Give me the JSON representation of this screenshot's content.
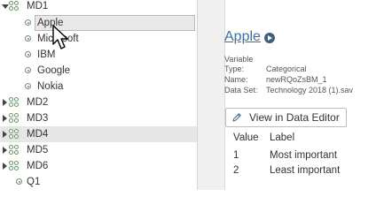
{
  "tree": {
    "groups": [
      {
        "label": "MD1",
        "expanded": true,
        "items": [
          "Apple",
          "Microsoft",
          "IBM",
          "Google",
          "Nokia"
        ]
      },
      {
        "label": "MD2",
        "expanded": false
      },
      {
        "label": "MD3",
        "expanded": false
      },
      {
        "label": "MD4",
        "expanded": false
      },
      {
        "label": "MD5",
        "expanded": false
      },
      {
        "label": "MD6",
        "expanded": false
      }
    ],
    "q1_label": "Q1",
    "selected_item": "Apple",
    "hover_group": "MD4"
  },
  "info": {
    "title": "Apple",
    "kind": "Variable",
    "type_key": "Type:",
    "type_value": "Categorical",
    "name_key": "Name:",
    "name_value": "newRQoZsBM_1",
    "dataset_key": "Data Set:",
    "dataset_value": "Technology 2018 (1).sav",
    "edit_button": "View in Data Editor",
    "table": {
      "headers": [
        "Value",
        "Label"
      ],
      "rows": [
        {
          "value": "1",
          "label": "Most important"
        },
        {
          "value": "2",
          "label": "Least important"
        }
      ]
    }
  },
  "colors": {
    "link": "#3a6ea5",
    "icon_green": "#6f8f6f",
    "row_hover": "#e6e6e6"
  }
}
